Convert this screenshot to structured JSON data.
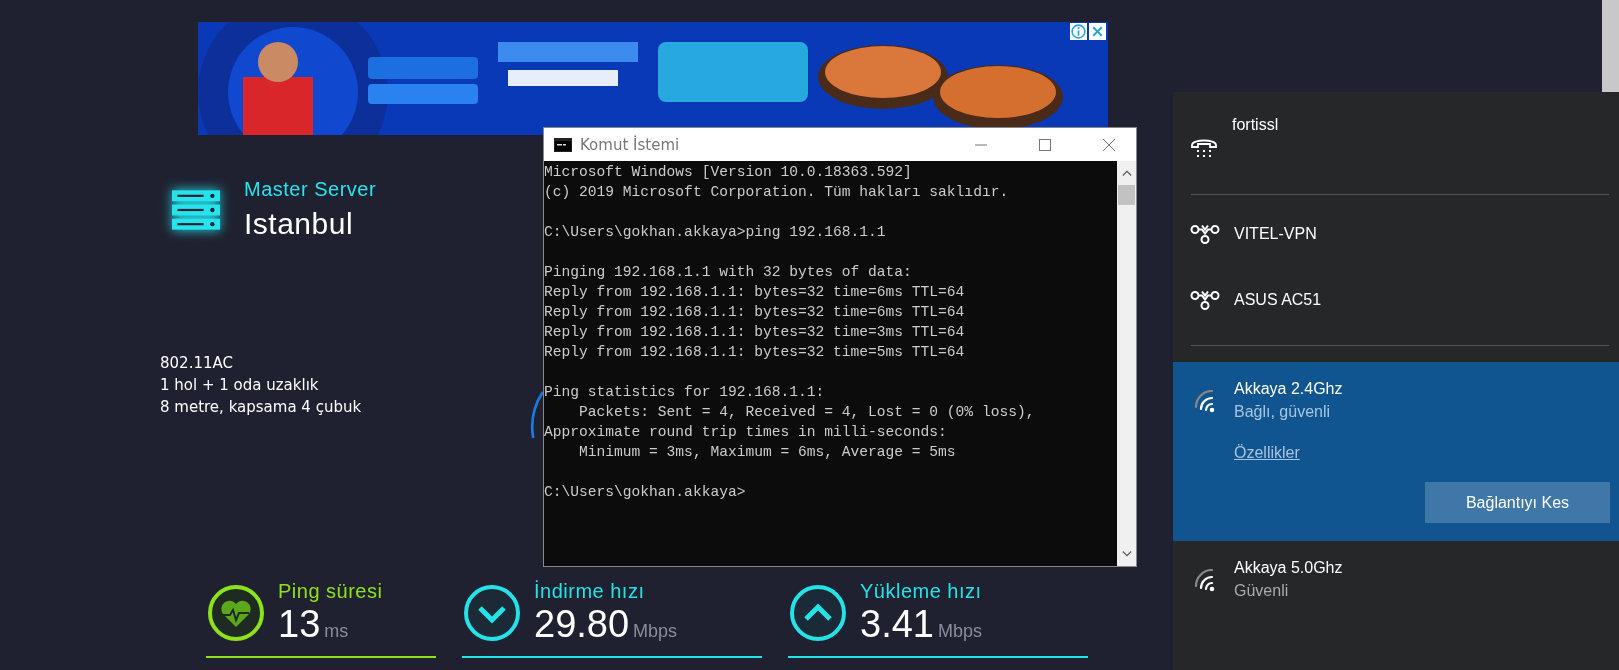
{
  "server": {
    "label": "Master Server",
    "city": "Istanbul"
  },
  "notes": [
    "802.11AC",
    "1 hol + 1 oda uzaklık",
    "8 metre, kapsama 4 çubuk"
  ],
  "metrics": [
    {
      "kind": "ping",
      "label": "Ping süresi",
      "value": "13",
      "unit": "ms",
      "color": "#8ee21b"
    },
    {
      "kind": "download",
      "label": "İndirme hızı",
      "value": "29.80",
      "unit": "Mbps",
      "color": "#22e3e8"
    },
    {
      "kind": "upload",
      "label": "Yükleme hızı",
      "value": "3.41",
      "unit": "Mbps",
      "color": "#22e3e8"
    }
  ],
  "console": {
    "title": "Komut İstemi",
    "blocks": [
      [
        "Microsoft Windows [Version 10.0.18363.592]",
        "(c) 2019 Microsoft Corporation. Tüm hakları saklıdır."
      ],
      [
        "C:\\Users\\gokhan.akkaya>ping 192.168.1.1"
      ],
      [
        "Pinging 192.168.1.1 with 32 bytes of data:",
        "Reply from 192.168.1.1: bytes=32 time=6ms TTL=64",
        "Reply from 192.168.1.1: bytes=32 time=6ms TTL=64",
        "Reply from 192.168.1.1: bytes=32 time=3ms TTL=64",
        "Reply from 192.168.1.1: bytes=32 time=5ms TTL=64"
      ],
      [
        "Ping statistics for 192.168.1.1:",
        "    Packets: Sent = 4, Received = 4, Lost = 0 (0% loss),",
        "Approximate round trip times in milli-seconds:",
        "    Minimum = 3ms, Maximum = 6ms, Average = 5ms"
      ],
      [
        "C:\\Users\\gokhan.akkaya>"
      ]
    ]
  },
  "network_flyout": {
    "groups": [
      [
        {
          "kind": "dialup",
          "name": "fortissl"
        }
      ],
      [
        {
          "kind": "vpn",
          "name": "VITEL-VPN"
        },
        {
          "kind": "vpn",
          "name": "ASUS AC51"
        }
      ],
      [
        {
          "kind": "wifi",
          "name": "Akkaya 2.4Ghz",
          "status": "Bağlı, güvenli",
          "selected": true,
          "link": "Özellikler",
          "button": "Bağlantıyı Kes"
        },
        {
          "kind": "wifi",
          "name": "Akkaya 5.0Ghz",
          "status": "Güvenli",
          "selected": false
        }
      ]
    ]
  }
}
